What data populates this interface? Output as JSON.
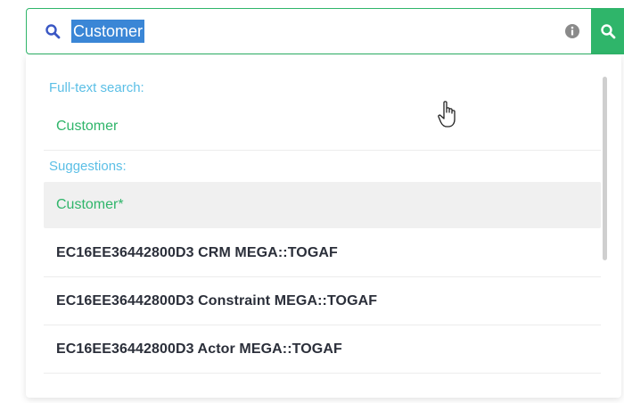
{
  "search": {
    "query": "Customer",
    "button_icon": "search-icon",
    "info_icon": "info-icon"
  },
  "dropdown": {
    "fulltext_label": "Full-text search:",
    "fulltext_item": "Customer",
    "suggestions_label": "Suggestions:",
    "suggestions": [
      "Customer*",
      "EC16EE36442800D3 CRM MEGA::TOGAF",
      "EC16EE36442800D3 Constraint MEGA::TOGAF",
      "EC16EE36442800D3 Actor MEGA::TOGAF"
    ]
  },
  "colors": {
    "accent_green": "#2fb56a",
    "label_blue": "#5bbfe6",
    "selection_blue": "#3a86d6"
  }
}
